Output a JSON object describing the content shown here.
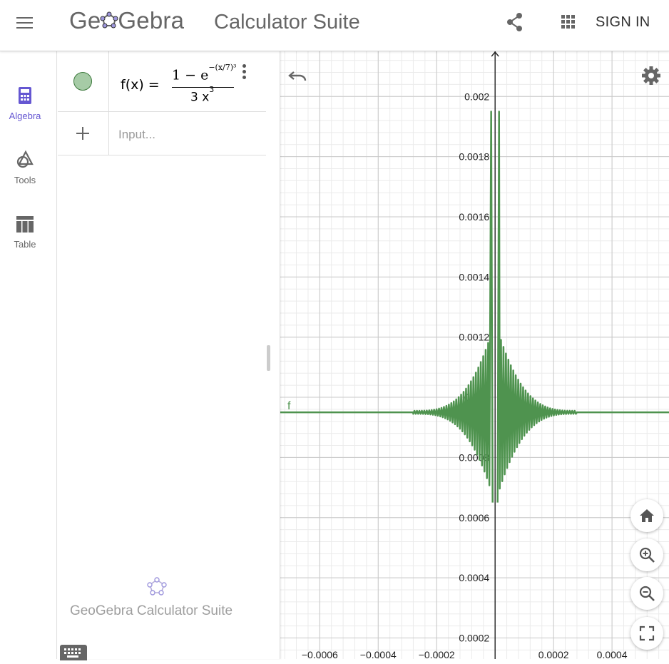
{
  "header": {
    "logo_text_1": "Ge",
    "logo_text_2": "Gebra",
    "title": "Calculator Suite",
    "share_icon": "share-icon",
    "apps_icon": "apps-grid-icon",
    "sign_in_label": "SIGN IN"
  },
  "rail": {
    "items": [
      {
        "label": "Algebra",
        "icon": "calculator-icon",
        "active": true
      },
      {
        "label": "Tools",
        "icon": "shapes-icon",
        "active": false
      },
      {
        "label": "Table",
        "icon": "table-icon",
        "active": false
      }
    ],
    "accent_color": "#6557d2"
  },
  "algebra": {
    "entries": [
      {
        "lhs": "f(x) =",
        "num_prefix": "1 − e",
        "num_exponent": "−(x/7)³",
        "den_base": "3 x",
        "den_exponent": "3",
        "color": "#4f934f"
      }
    ],
    "input_placeholder": "Input...",
    "footer_text": "GeoGebra Calculator Suite"
  },
  "chart_data": {
    "type": "line",
    "function_label": "f",
    "series": [
      {
        "name": "f",
        "color": "#4f934f",
        "x": [
          -0.00065,
          -0.00045,
          -0.00025,
          -0.00012,
          -5e-05,
          -3e-05,
          -2e-05,
          -1.5e-05,
          -1e-05,
          1e-05,
          1.5e-05,
          2e-05,
          3e-05,
          5e-05,
          0.00012,
          0.00025,
          0.00045,
          0.00065
        ],
        "y": [
          0.00095,
          0.00095,
          0.00095,
          0.00095,
          0.00095,
          0.0013,
          0.0006,
          0.00195,
          0.00065,
          0.00065,
          0.00195,
          0.0006,
          0.0013,
          0.00095,
          0.00095,
          0.00095,
          0.00095,
          0.00095
        ]
      }
    ],
    "x_ticks": [
      "−0.0006",
      "−0.0004",
      "−0.0002",
      "0.0002",
      "0.0004"
    ],
    "y_ticks": [
      "0.0002",
      "0.0004",
      "0.0006",
      "0.0008",
      "0.001",
      "0.0012",
      "0.0014",
      "0.0016",
      "0.0018",
      "0.002"
    ],
    "xlim": [
      -0.000735,
      0.000595
    ],
    "ylim": [
      0.00013,
      0.00215
    ],
    "grid": true
  }
}
